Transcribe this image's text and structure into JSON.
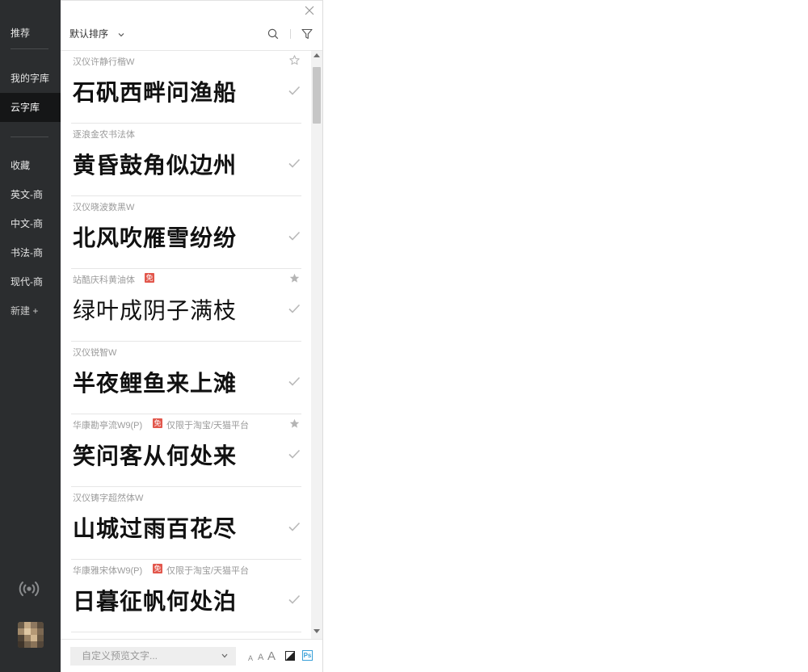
{
  "sidebar": {
    "top": "推荐",
    "library": [
      "我的字库",
      "云字库"
    ],
    "categories": [
      "收藏",
      "英文-商",
      "中文-商",
      "书法-商",
      "现代-商"
    ],
    "new_label": "新建 +"
  },
  "toolbar": {
    "sort_label": "默认排序"
  },
  "fonts": [
    {
      "name": "汉仪许静行楷W",
      "preview": "石矾西畔问渔船",
      "starred": false,
      "free_badge": "",
      "restriction": ""
    },
    {
      "name": "逐浪金农书法体",
      "preview": "黄昏鼓角似边州",
      "starred": false,
      "free_badge": "",
      "restriction": ""
    },
    {
      "name": "汉仪晓波数黑W",
      "preview": "北风吹雁雪纷纷",
      "starred": false,
      "free_badge": "",
      "restriction": ""
    },
    {
      "name": "站酷庆科黄油体",
      "preview": "绿叶成阴子满枝",
      "starred": true,
      "free_badge": "免",
      "restriction": ""
    },
    {
      "name": "汉仪锐智W",
      "preview": "半夜鲤鱼来上滩",
      "starred": false,
      "free_badge": "",
      "restriction": ""
    },
    {
      "name": "华康勘亭流W9(P)",
      "preview": "笑问客从何处来",
      "starred": true,
      "free_badge": "免",
      "restriction": "仅限于淘宝/天猫平台"
    },
    {
      "name": "汉仪铸字超然体W",
      "preview": "山城过雨百花尽",
      "starred": false,
      "free_badge": "",
      "restriction": ""
    },
    {
      "name": "华康雅宋体W9(P)",
      "preview": "日暮征帆何处泊",
      "starred": false,
      "free_badge": "免",
      "restriction": "仅限于淘宝/天猫平台"
    }
  ],
  "footer": {
    "preview_placeholder": "自定义预览文字...",
    "size_small": "A",
    "size_medium": "A",
    "size_large": "A",
    "ps_label": "Ps"
  },
  "icons": [
    "close-icon",
    "chevron-down-icon",
    "search-icon",
    "filter-icon",
    "star-icon",
    "check-icon",
    "radio-broadcast-icon",
    "contrast-icon",
    "ps-icon"
  ],
  "colors": {
    "sidebar_bg": "#2b2d2f",
    "sidebar_active": "#151617",
    "badge": "#e2574c",
    "ps_blue": "#3ba1d8"
  }
}
